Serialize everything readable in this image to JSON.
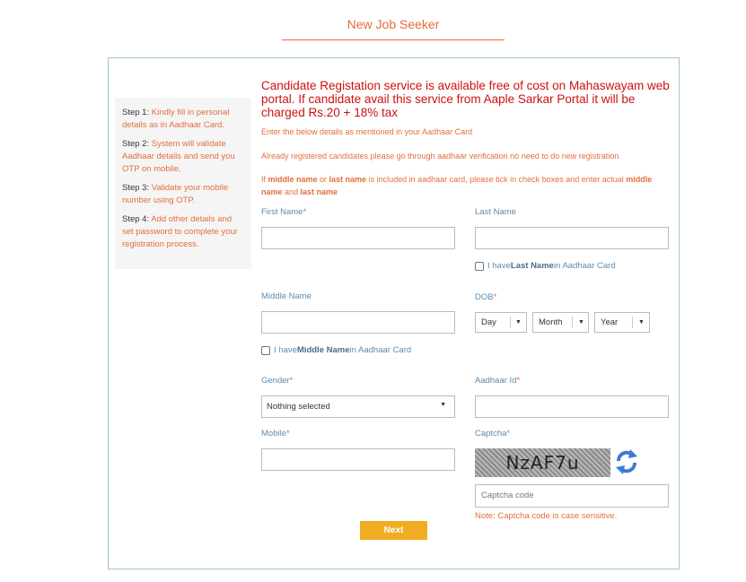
{
  "header": {
    "title": "New Job Seeker"
  },
  "steps": [
    {
      "label": "Step 1:",
      "text": "Kindly fill in personal details as in Aadhaar Card."
    },
    {
      "label": "Step 2:",
      "text": "System will validate Aadhaar details and send you OTP on mobile."
    },
    {
      "label": "Step 3:",
      "text": "Validate your mobile number using OTP."
    },
    {
      "label": "Step 4:",
      "text": "Add other details and set password to complete your registration process."
    }
  ],
  "notice": "Candidate Registation service is available free of cost on Mahaswayam web portal. If candidate avail this service from Aaple Sarkar Portal it will be charged Rs.20 + 18% tax",
  "info": {
    "line1": "Enter the below details as mentioned in your Aadhaar Card",
    "line2": "Already registered candidates please go through aadhaar verification no need to do new registration",
    "line3_a": "If ",
    "line3_b": "middle name",
    "line3_c": " or ",
    "line3_d": "last name",
    "line3_e": " is included in aadhaar card, please tick in check boxes and enter actual ",
    "line3_f": "middle name",
    "line3_g": " and ",
    "line3_h": "last name"
  },
  "form": {
    "first_name_label": "First Name",
    "last_name_label": "Last Name",
    "last_name_check_a": "I have",
    "last_name_check_b": "Last Name",
    "last_name_check_c": " in Aadhaar Card",
    "middle_name_label": "Middle Name",
    "middle_name_check_a": "I have ",
    "middle_name_check_b": "Middle Name",
    "middle_name_check_c": " in Aadhaar Card",
    "dob_label": "DOB",
    "dob_day": "Day",
    "dob_month": "Month",
    "dob_year": "Year",
    "gender_label": "Gender",
    "gender_value": "Nothing selected",
    "aadhaar_label": "Aadhaar Id",
    "mobile_label": "Mobile",
    "captcha_label": "Captcha",
    "captcha_text": "NzAF7u",
    "captcha_placeholder": "Captcha code",
    "captcha_note": "Note: Captcha code is case sensitive.",
    "required_mark": "*",
    "next_label": "Next"
  },
  "colors": {
    "accent": "#e36e3a",
    "notice": "#cc1111",
    "button": "#f0ad22",
    "label": "#5a8bb0"
  }
}
